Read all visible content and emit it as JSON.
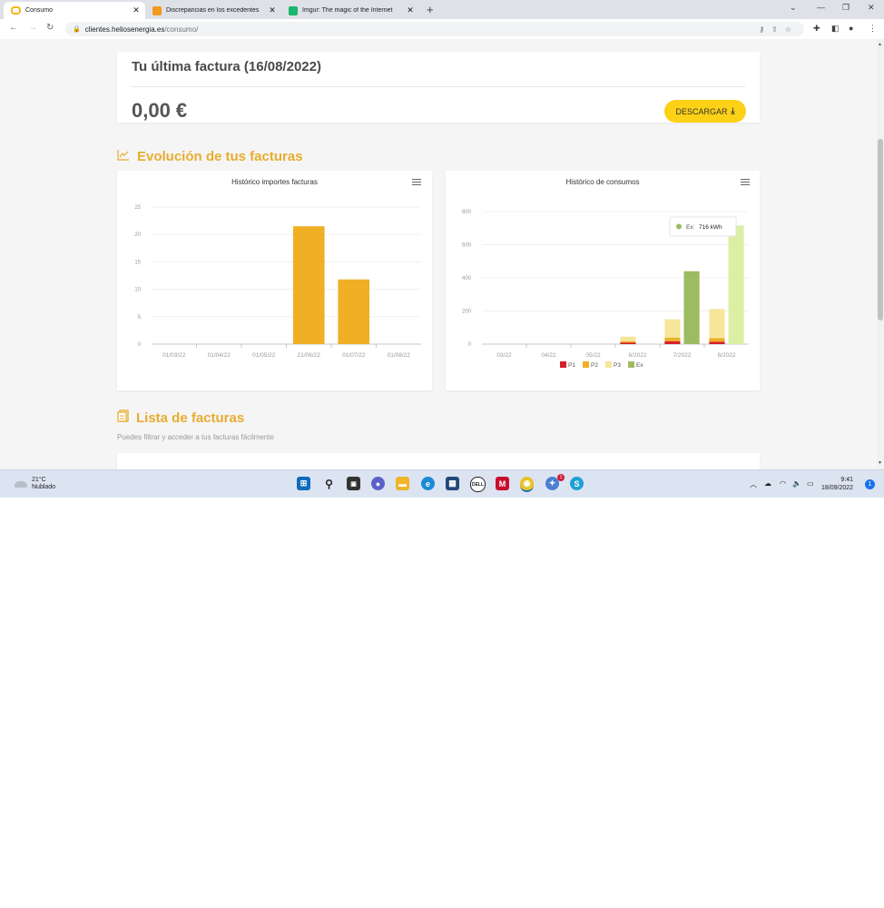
{
  "browser": {
    "tabs": [
      {
        "title": "Consumo",
        "active": true
      },
      {
        "title": "Discrepancias en los excedentes",
        "active": false
      },
      {
        "title": "Imgur: The magic of the Internet",
        "active": false
      }
    ],
    "url_host": "clientes.heliosenergia.es",
    "url_path": "/consumo/"
  },
  "invoice": {
    "title": "Tu última factura (16/08/2022)",
    "amount": "0,00 €",
    "download_label": "DESCARGAR"
  },
  "evolution": {
    "title": "Evolución de tus facturas"
  },
  "chart_data": [
    {
      "type": "bar",
      "title": "Histórico importes facturas",
      "categories": [
        "01/03/22",
        "01/04/22",
        "01/05/22",
        "21/06/22",
        "01/07/22",
        "01/08/22"
      ],
      "values": [
        0,
        0,
        0,
        21.5,
        11.8,
        0
      ],
      "yticks": [
        "0",
        "5",
        "10",
        "15",
        "20",
        "25"
      ],
      "ylim": [
        0,
        25
      ],
      "color": "#efb026"
    },
    {
      "type": "bar",
      "stacked": true,
      "title": "Histórico de consumos",
      "categories": [
        "03/22",
        "04/22",
        "05/22",
        "6/2022",
        "7/2022",
        "8/2022"
      ],
      "yticks": [
        "0",
        "200",
        "400",
        "600",
        "800"
      ],
      "ylim": [
        0,
        800
      ],
      "series": [
        {
          "name": "P1",
          "color": "#d62027",
          "values": [
            0,
            0,
            0,
            10,
            18,
            15
          ]
        },
        {
          "name": "P2",
          "color": "#efb026",
          "values": [
            0,
            0,
            0,
            8,
            22,
            22
          ]
        },
        {
          "name": "P3",
          "color": "#f7e59a",
          "values": [
            0,
            0,
            0,
            27,
            110,
            175
          ]
        },
        {
          "name": "Ex",
          "color": "#9dbb61",
          "values": [
            0,
            0,
            0,
            0,
            440,
            716
          ]
        }
      ],
      "legend_position": "bottom",
      "tooltip": {
        "series": "Ex",
        "text": "716 kWh"
      }
    }
  ],
  "invoice_list": {
    "title": "Lista de facturas",
    "subtitle": "Puedes filtrar y acceder a tus facturas fácilmente"
  },
  "taskbar": {
    "temperature": "21°C",
    "weather": "Nublado",
    "time": "9:41",
    "date": "18/09/2022",
    "notifications": "1",
    "app_badge": "1"
  }
}
